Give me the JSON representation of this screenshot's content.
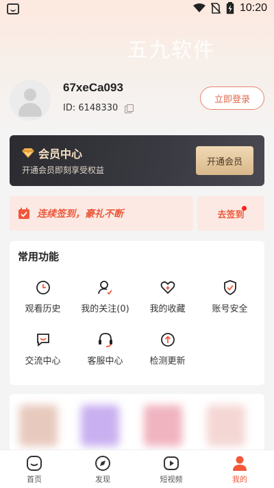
{
  "status_bar": {
    "time": "10:20"
  },
  "watermark": "五九软件",
  "profile": {
    "username": "67xeCa093",
    "id_label": "ID: 6148330",
    "login_button": "立即登录"
  },
  "vip": {
    "title": "会员中心",
    "subtitle": "开通会员即刻享受权益",
    "button": "开通会员"
  },
  "signin": {
    "slogan": "连续签到，豪礼不断",
    "button": "去签到"
  },
  "functions": {
    "title": "常用功能",
    "items": [
      {
        "label": "观看历史",
        "icon": "clock-icon"
      },
      {
        "label": "我的关注(0)",
        "icon": "user-check-icon"
      },
      {
        "label": "我的收藏",
        "icon": "heart-plus-icon"
      },
      {
        "label": "账号安全",
        "icon": "shield-check-icon"
      },
      {
        "label": "交流中心",
        "icon": "chat-icon"
      },
      {
        "label": "客服中心",
        "icon": "headset-icon"
      },
      {
        "label": "检测更新",
        "icon": "upload-circle-icon"
      }
    ]
  },
  "tabbar": {
    "items": [
      {
        "label": "首页",
        "icon": "home-icon"
      },
      {
        "label": "发现",
        "icon": "compass-icon"
      },
      {
        "label": "短视频",
        "icon": "play-icon"
      },
      {
        "label": "我的",
        "icon": "person-icon",
        "active": true
      }
    ]
  },
  "colors": {
    "accent": "#f2573a",
    "vip_gold": "#f0d9b5",
    "vip_dark": "#2b2b30"
  }
}
